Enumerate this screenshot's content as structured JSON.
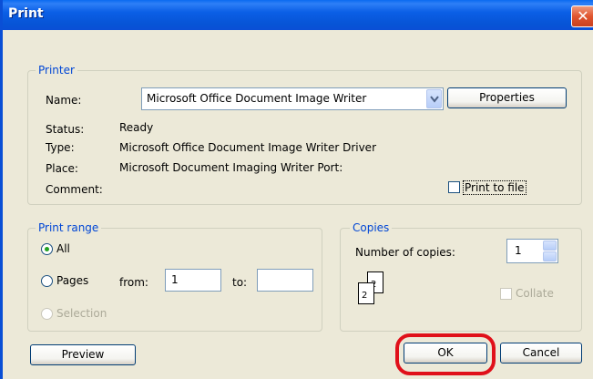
{
  "window": {
    "title": "Print",
    "close_icon": "close-icon"
  },
  "printer": {
    "legend": "Printer",
    "name_label": "Name:",
    "name_value": "Microsoft Office Document Image Writer",
    "properties_button": "Properties",
    "status_label": "Status:",
    "status_value": "Ready",
    "type_label": "Type:",
    "type_value": "Microsoft Office Document Image Writer Driver",
    "place_label": "Place:",
    "place_value": "Microsoft Document Imaging Writer Port:",
    "comment_label": "Comment:",
    "print_to_file_label": "Print to file",
    "print_to_file_checked": false
  },
  "print_range": {
    "legend": "Print range",
    "all_label": "All",
    "all_selected": true,
    "pages_label": "Pages",
    "from_label": "from:",
    "from_value": "1",
    "to_label": "to:",
    "to_value": "",
    "selection_label": "Selection"
  },
  "copies": {
    "legend": "Copies",
    "number_label": "Number of copies:",
    "number_value": "1",
    "collate_label": "Collate",
    "icon_pages": [
      "2",
      "2"
    ]
  },
  "footer": {
    "preview_button": "Preview",
    "ok_button": "OK",
    "cancel_button": "Cancel"
  },
  "colors": {
    "titlebar": "#0a5fe6",
    "legend_text": "#0046d5",
    "highlight": "#e0101a",
    "dialog_bg": "#ece9d8"
  }
}
